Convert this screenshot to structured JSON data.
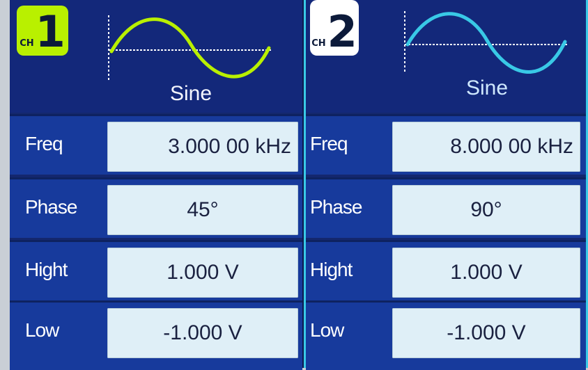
{
  "channels": [
    {
      "badge_prefix": "CH",
      "badge_number": "1",
      "waveform": "Sine",
      "color": "#b9f000",
      "params": {
        "freq_label": "Freq",
        "freq_value": "3.000 00 kHz",
        "phase_label": "Phase",
        "phase_value": "45°",
        "high_label": "Hight",
        "high_value": "1.000 V",
        "low_label": "Low",
        "low_value": "-1.000 V"
      }
    },
    {
      "badge_prefix": "CH",
      "badge_number": "2",
      "waveform": "Sine",
      "color": "#39c9e6",
      "params": {
        "freq_label": "Freq",
        "freq_value": "8.000 00 kHz",
        "phase_label": "Phase",
        "phase_value": "90°",
        "high_label": "Hight",
        "high_value": "1.000 V",
        "low_label": "Low",
        "low_value": "-1.000 V"
      }
    }
  ]
}
